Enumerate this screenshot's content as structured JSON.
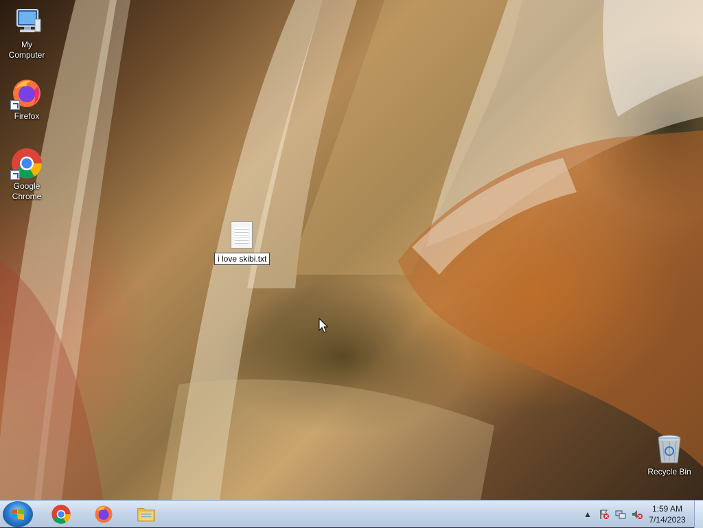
{
  "desktop": {
    "icons": [
      {
        "label": "My Computer",
        "icon": "computer-icon"
      },
      {
        "label": "Firefox",
        "icon": "firefox-icon"
      },
      {
        "label": "Google Chrome",
        "icon": "chrome-icon"
      },
      {
        "label": "Recycle Bin",
        "icon": "recycle-bin-icon"
      }
    ],
    "file": {
      "icon": "text-file-icon",
      "rename_value": "i love skibi.txt"
    }
  },
  "taskbar": {
    "start": {
      "icon": "windows-start-icon"
    },
    "pinned": [
      {
        "name": "Google Chrome",
        "icon": "chrome-icon"
      },
      {
        "name": "Firefox",
        "icon": "firefox-icon"
      },
      {
        "name": "Windows Explorer",
        "icon": "folder-icon"
      }
    ],
    "tray": {
      "icons": [
        "show-hidden-icons-chevron",
        "action-center-flag-icon",
        "network-icon",
        "volume-muted-icon"
      ],
      "time": "1:59 AM",
      "date": "7/14/2023"
    }
  },
  "colors": {
    "taskbar_top": "#dfe9f5",
    "taskbar_bottom": "#b3c7e0",
    "chrome_red": "#db4437",
    "chrome_green": "#0f9d58",
    "chrome_yellow": "#f4b400",
    "chrome_blue": "#4285f4",
    "firefox_orange": "#ff7139",
    "firefox_purple": "#7542e5"
  }
}
